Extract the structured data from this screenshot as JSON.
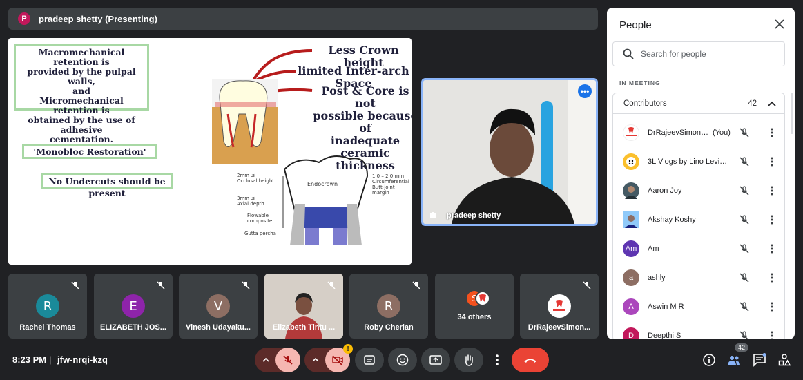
{
  "topbar": {
    "avatar_letter": "P",
    "title": "pradeep shetty (Presenting)"
  },
  "slide": {
    "box1": [
      "Macromechanical retention is",
      "provided by the pulpal walls,",
      "and",
      "Micromechanical retention is",
      "obtained by the use of adhesive",
      "cementation."
    ],
    "box2": "'Monobloc Restoration'",
    "box3": "No Undercuts should be present",
    "point1": "Less Crown height",
    "point2": "limited Inter-arch Space",
    "point3": [
      "Post & Core is not",
      "possible because of",
      "inadequate ceramic",
      "thickness"
    ],
    "diagram": {
      "occlusal": [
        "2mm ≤",
        "Occlusal height"
      ],
      "axial": [
        "3mm ≤",
        "Axial depth"
      ],
      "flowable": [
        "Flowable",
        "composite"
      ],
      "gutta": "Gutta percha",
      "endocrown": "Endocrown",
      "margin": [
        "1.0 – 2.0 mm",
        "Circumferential",
        "Butt-joint margin"
      ]
    }
  },
  "presenter_tile": {
    "name": "pradeep shetty",
    "more_icon": "more-horiz-icon"
  },
  "tiles": [
    {
      "name": "Rachel Thomas",
      "letter": "R",
      "color": "#1a8a9a"
    },
    {
      "name": "ELIZABETH JOS...",
      "letter": "E",
      "color": "#8e24aa"
    },
    {
      "name": "Vinesh Udayaku...",
      "letter": "V",
      "color": "#8d6e63"
    },
    {
      "name": "Elizabeth Tintu ...",
      "letter": "",
      "color": "#cfc8c2"
    },
    {
      "name": "Roby Cherian",
      "letter": "R",
      "color": "#8d6e63"
    },
    {
      "name": "34 others",
      "letter": "S",
      "color": "#f4511e"
    },
    {
      "name": "DrRajeevSimon...",
      "letter": "",
      "color": "#ffffff"
    }
  ],
  "bottom": {
    "time": "8:23 PM",
    "separator": "|",
    "meeting_code": "jfw-nrqi-kzq",
    "cam_badge": "!",
    "people_count": "42"
  },
  "panel": {
    "title": "People",
    "search_placeholder": "Search for people",
    "section": "IN MEETING",
    "group": "Contributors",
    "group_count": "42",
    "you_label": "(You)",
    "people": [
      {
        "name": "DrRajeevSimonK ...",
        "letter": "",
        "color": "#ffffff"
      },
      {
        "name": "3L Vlogs by Lino Levin L...",
        "letter": "",
        "color": "#fbc02d"
      },
      {
        "name": "Aaron Joy",
        "letter": "",
        "color": "#455a64"
      },
      {
        "name": "Akshay Koshy",
        "letter": "",
        "color": "#37474f"
      },
      {
        "name": "Am",
        "letter": "Am",
        "color": "#5e35b1"
      },
      {
        "name": "ashly",
        "letter": "a",
        "color": "#8d6e63"
      },
      {
        "name": "Aswin M R",
        "letter": "A",
        "color": "#ab47bc"
      },
      {
        "name": "Deepthi S",
        "letter": "D",
        "color": "#c2185b"
      }
    ]
  }
}
